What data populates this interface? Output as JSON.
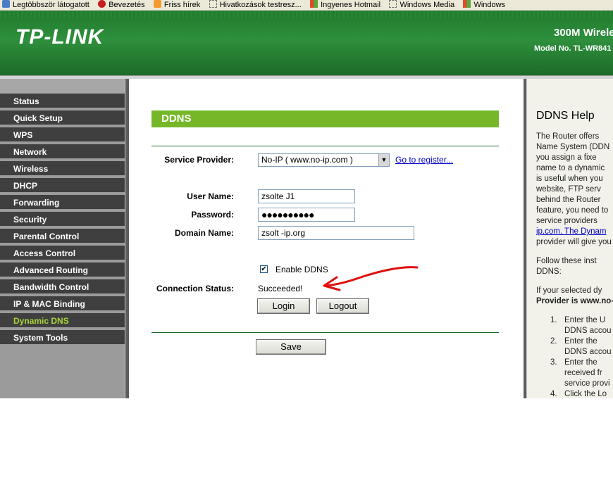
{
  "bookmarks": [
    {
      "label": "Legtöbbször látogatott",
      "icon": "globe-icon"
    },
    {
      "label": "Bevezetés",
      "icon": "firefox-icon"
    },
    {
      "label": "Friss hírek",
      "icon": "rss-icon"
    },
    {
      "label": "Hivatkozások testresz...",
      "icon": "page-icon"
    },
    {
      "label": "Ingyenes Hotmail",
      "icon": "windows-icon"
    },
    {
      "label": "Windows Media",
      "icon": "page-icon"
    },
    {
      "label": "Windows",
      "icon": "windows-icon"
    }
  ],
  "header": {
    "logo": "TP-LINK",
    "product": "300M Wirele",
    "model": "Model No. TL-WR841"
  },
  "sidebar": {
    "items": [
      {
        "label": "Status"
      },
      {
        "label": "Quick Setup"
      },
      {
        "label": "WPS"
      },
      {
        "label": "Network"
      },
      {
        "label": "Wireless"
      },
      {
        "label": "DHCP"
      },
      {
        "label": "Forwarding"
      },
      {
        "label": "Security"
      },
      {
        "label": "Parental Control"
      },
      {
        "label": "Access Control"
      },
      {
        "label": "Advanced Routing"
      },
      {
        "label": "Bandwidth Control"
      },
      {
        "label": "IP & MAC Binding"
      },
      {
        "label": "Dynamic DNS",
        "active": true
      },
      {
        "label": "System Tools"
      }
    ]
  },
  "main": {
    "title": "DDNS",
    "service_provider_label": "Service Provider:",
    "service_provider_value": "No-IP ( www.no-ip.com )",
    "register_link": "Go to register...",
    "username_label": "User Name:",
    "username_value": "zsolte        J1",
    "password_label": "Password:",
    "password_value": "●●●●●●●●●●",
    "domain_label": "Domain Name:",
    "domain_value": "zsolt          -ip.org",
    "enable_ddns_label": "Enable DDNS",
    "enable_ddns_checked": "✔",
    "connection_status_label": "Connection Status:",
    "connection_status_value": "Succeeded!",
    "login_button": "Login",
    "logout_button": "Logout",
    "save_button": "Save"
  },
  "help": {
    "title": "DDNS Help",
    "para1": [
      "The Router offers",
      "Name System (DDN",
      "you assign a fixe",
      "name to a dynamic",
      "is useful when you",
      "website, FTP serv",
      "behind the Router",
      "feature, you need to",
      "service providers",
      "ip.com. The Dynam",
      "provider will give you"
    ],
    "para2": [
      "Follow these inst",
      "DDNS:"
    ],
    "para3": [
      "If your selected dy",
      "Provider is www.no-"
    ],
    "steps": [
      {
        "num": "1.",
        "lines": [
          "Enter the U",
          "DDNS accou"
        ]
      },
      {
        "num": "2.",
        "lines": [
          "Enter the",
          "DDNS accou"
        ]
      },
      {
        "num": "3.",
        "lines": [
          "Enter the",
          "received fr",
          "service provi"
        ]
      },
      {
        "num": "4.",
        "lines": [
          "Click the Lo"
        ]
      }
    ]
  },
  "colors": {
    "header_green": "#2e8f3c",
    "title_bar_green": "#76b72a",
    "sidebar_item": "#3f3f3f",
    "active_item": "#a7d63a"
  }
}
